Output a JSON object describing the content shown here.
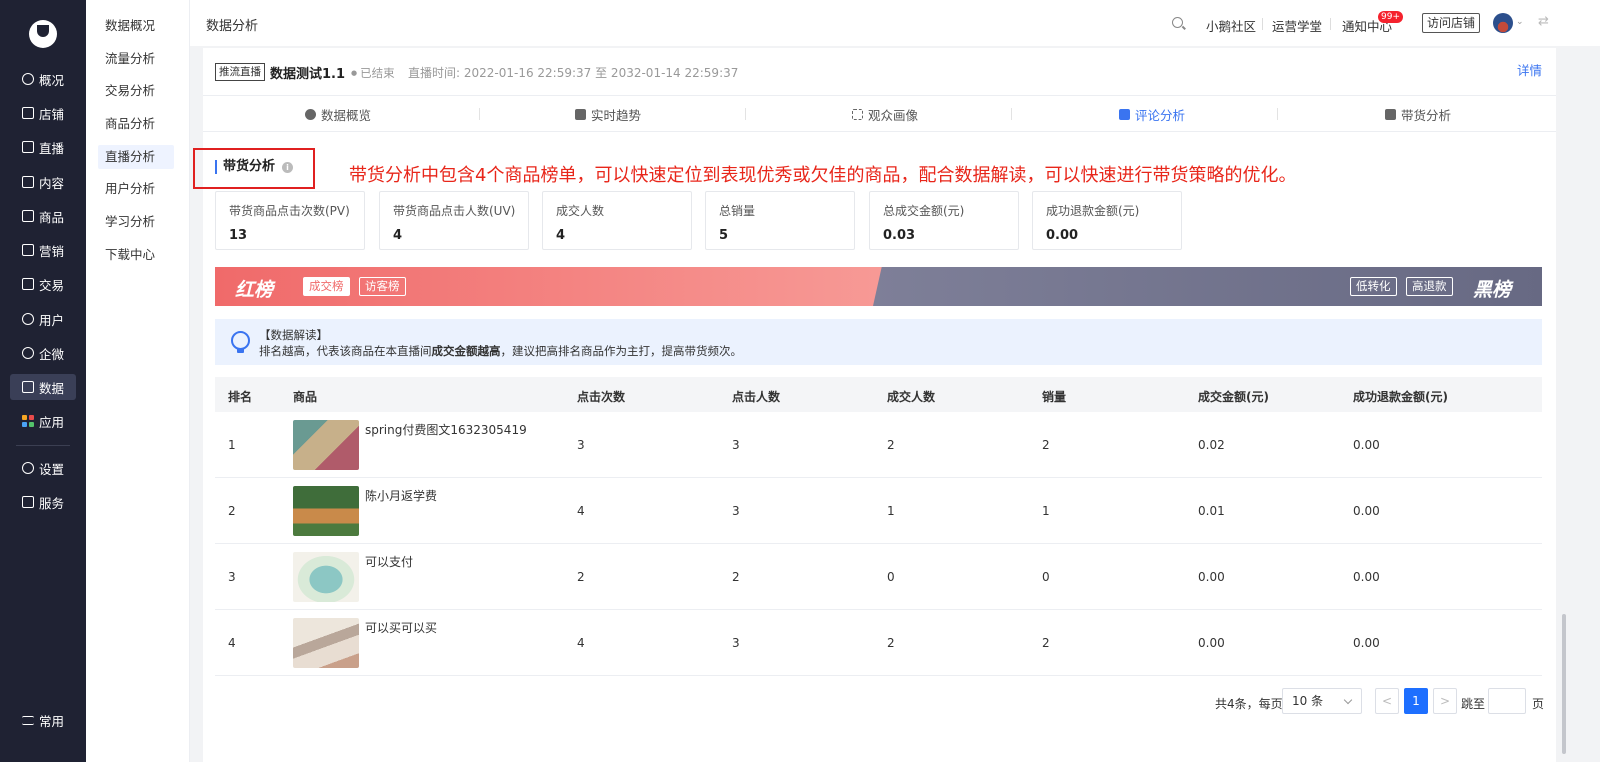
{
  "nav": {
    "items": [
      {
        "label": "概况",
        "icon": "pie-chart-icon"
      },
      {
        "label": "店铺",
        "icon": "store-icon"
      },
      {
        "label": "直播",
        "icon": "live-icon"
      },
      {
        "label": "内容",
        "icon": "document-icon"
      },
      {
        "label": "商品",
        "icon": "product-icon"
      },
      {
        "label": "营销",
        "icon": "megaphone-icon"
      },
      {
        "label": "交易",
        "icon": "trade-icon"
      },
      {
        "label": "用户",
        "icon": "user-icon"
      },
      {
        "label": "企微",
        "icon": "wecom-icon"
      },
      {
        "label": "数据",
        "icon": "data-icon"
      },
      {
        "label": "应用",
        "icon": "apps-icon"
      },
      {
        "label": "设置",
        "icon": "settings-icon"
      },
      {
        "label": "服务",
        "icon": "service-icon"
      }
    ],
    "bottom": {
      "label": "常用",
      "icon": "list-icon"
    },
    "active": "数据"
  },
  "subnav": {
    "items": [
      "数据概况",
      "流量分析",
      "交易分析",
      "商品分析",
      "直播分析",
      "用户分析",
      "学习分析",
      "下载中心"
    ],
    "active": "直播分析"
  },
  "topbar": {
    "title": "数据分析",
    "links": [
      "小鹅社区",
      "运营学堂",
      "通知中心"
    ],
    "badge": "99+",
    "visit_store": "访问店铺"
  },
  "live": {
    "tag": "推流直播",
    "name": "数据测试1.1",
    "status": "已结束",
    "time": "直播时间: 2022-01-16 22:59:37 至 2032-01-14 22:59:37",
    "detail": "详情"
  },
  "tabs": [
    {
      "label": "数据概览",
      "icon": "pie-icon"
    },
    {
      "label": "实时趋势",
      "icon": "trend-icon"
    },
    {
      "label": "观众画像",
      "icon": "portrait-icon"
    },
    {
      "label": "评论分析",
      "icon": "comment-icon"
    },
    {
      "label": "带货分析",
      "icon": "bag-icon"
    }
  ],
  "active_tab": "评论分析",
  "section": {
    "title": "带货分析",
    "annotation": "带货分析中包含4个商品榜单，可以快速定位到表现优秀或欠佳的商品，配合数据解读，可以快速进行带货策略的优化。"
  },
  "stats": [
    {
      "label": "带货商品点击次数(PV)",
      "value": "13"
    },
    {
      "label": "带货商品点击人数(UV)",
      "value": "4"
    },
    {
      "label": "成交人数",
      "value": "4"
    },
    {
      "label": "总销量",
      "value": "5"
    },
    {
      "label": "总成交金额(元)",
      "value": "0.03"
    },
    {
      "label": "成功退款金额(元)",
      "value": "0.00"
    }
  ],
  "ranking": {
    "red_title": "红榜",
    "red_tabs": [
      "成交榜",
      "访客榜"
    ],
    "red_active": "成交榜",
    "black_title": "黑榜",
    "black_tabs": [
      "低转化",
      "高退款"
    ]
  },
  "tip": {
    "title": "【数据解读】",
    "text_prefix": "排名越高，代表该商品在本直播间",
    "text_bold": "成交金额越高",
    "text_suffix": "，建议把高排名商品作为主打，提高带货频次。"
  },
  "table": {
    "headers": [
      "排名",
      "商品",
      "点击次数",
      "点击人数",
      "成交人数",
      "销量",
      "成交金额(元)",
      "成功退款金额(元)"
    ],
    "rows": [
      {
        "rank": "1",
        "name": "spring付费图文1632305419",
        "clicks": "3",
        "visitors": "3",
        "buyers": "2",
        "sales": "2",
        "amount": "0.02",
        "refund": "0.00",
        "thumb": "dog-portrait"
      },
      {
        "rank": "2",
        "name": "陈小月返学费",
        "clicks": "4",
        "visitors": "3",
        "buyers": "1",
        "sales": "1",
        "amount": "0.01",
        "refund": "0.00",
        "thumb": "dog-grass"
      },
      {
        "rank": "3",
        "name": "可以支付",
        "clicks": "2",
        "visitors": "2",
        "buyers": "0",
        "sales": "0",
        "amount": "0.00",
        "refund": "0.00",
        "thumb": "island-hammock"
      },
      {
        "rank": "4",
        "name": "可以买可以买",
        "clicks": "4",
        "visitors": "3",
        "buyers": "2",
        "sales": "2",
        "amount": "0.00",
        "refund": "0.00",
        "thumb": "ink-flowers"
      }
    ]
  },
  "pager": {
    "total": "共4条，每页",
    "size": "10 条",
    "prev": "<",
    "current": "1",
    "next": ">",
    "jump": "跳至",
    "page": "页"
  },
  "colors": {
    "nav_bg": "#1f2233",
    "accent": "#3a74f0",
    "red_board": "#f06a6a",
    "black_board": "#707290",
    "annotation": "#e8261a"
  }
}
